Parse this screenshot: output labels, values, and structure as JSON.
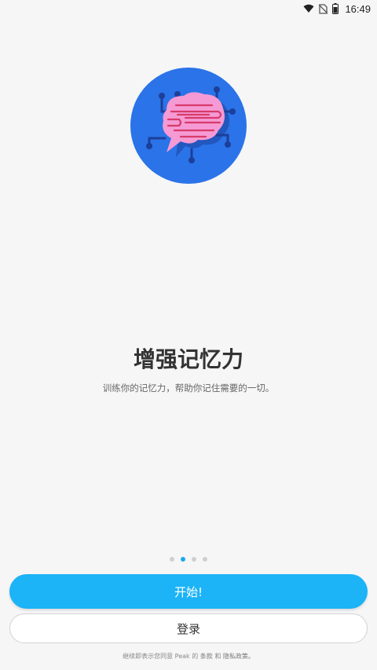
{
  "status_bar": {
    "time": "16:49",
    "icons": [
      "wifi-icon",
      "no-sim-icon",
      "battery-icon"
    ]
  },
  "hero": {
    "icon": "brain-circuit-icon",
    "colors": {
      "circle": "#2b73e8",
      "brain": "#f59ad4",
      "lines": "#d83a6a",
      "circuit": "#1c3f9a"
    }
  },
  "onboarding": {
    "title": "增强记忆力",
    "subtitle": "训练你的记忆力，帮助你记住需要的一切。",
    "page_indicator": {
      "total": 4,
      "active": 2
    }
  },
  "actions": {
    "start_label": "开始!",
    "login_label": "登录"
  },
  "legal": {
    "prefix": "继续即表示您同意 Peak 的",
    "terms": "条款",
    "and": "和",
    "privacy": "隐私政策。"
  },
  "colors": {
    "accent": "#1cb3f7",
    "background": "#f6f6f7",
    "dot_active": "#1aa8f0",
    "dot_inactive": "#cfcfcf"
  }
}
